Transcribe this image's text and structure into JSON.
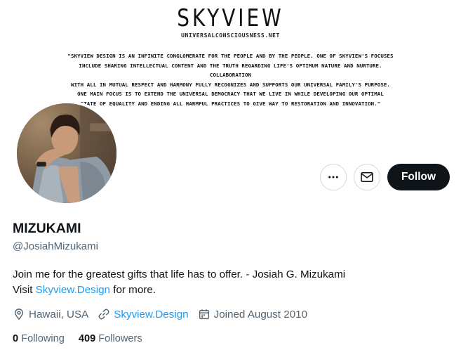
{
  "banner": {
    "logo": "SKYVIEW",
    "subtitle": "UNIVERSALCONSCIOUSNESS.NET",
    "quote_lines": [
      "\"SKYVIEW DESIGN IS AN INFINITE CONGLOMERATE FOR THE PEOPLE AND BY THE PEOPLE. ONE OF SKYVIEW'S FOCUSES",
      "INCLUDE SHARING INTELLECTUAL CONTENT AND THE TRUTH REGARDING LIFE'S OPTIMUM NATURE AND NURTURE. COLLABORATION",
      "WITH ALL IN MUTUAL RESPECT AND HARMONY FULLY RECOGNIZES AND SUPPORTS OUR UNIVERSAL FAMILY'S PURPOSE.",
      "ONE MAIN FOCUS IS TO EXTEND THE UNIVERSAL DEMOCRACY THAT WE LIVE IN WHILE DEVELOPING OUR OPTIMAL",
      "STATE OF EQUALITY AND ENDING ALL HARMFUL PRACTICES TO GIVE WAY TO RESTORATION AND INNOVATION.\""
    ]
  },
  "actions": {
    "more_icon": "ellipsis-icon",
    "message_icon": "envelope-icon",
    "follow_label": "Follow"
  },
  "profile": {
    "display_name": "MIZUKAMI",
    "handle": "@JosiahMizukami",
    "bio_line1": "Join me for the greatest gifts that life has to offer. - Josiah G. Mizukami",
    "bio_visit": "Visit ",
    "bio_link": "Skyview.Design",
    "bio_after": " for more.",
    "location": "Hawaii, USA",
    "website": "Skyview.Design",
    "joined": "Joined August 2010"
  },
  "stats": {
    "following_count": "0",
    "following_label": "Following",
    "followers_count": "409",
    "followers_label": "Followers"
  },
  "colors": {
    "accent": "#1d9bf0",
    "text_primary": "#0f1419",
    "text_secondary": "#536471",
    "follow_bg": "#0f1419"
  }
}
